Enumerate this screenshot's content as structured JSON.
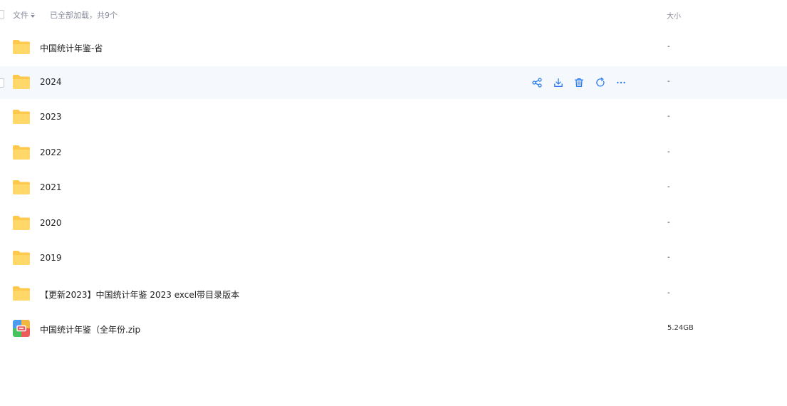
{
  "header": {
    "file_column_label": "文件",
    "load_status": "已全部加载，共9个",
    "size_column_label": "大小"
  },
  "files": [
    {
      "name": "中国统计年鉴-省",
      "size": "-",
      "type": "folder"
    },
    {
      "name": "2024",
      "size": "-",
      "type": "folder"
    },
    {
      "name": "2023",
      "size": "-",
      "type": "folder"
    },
    {
      "name": "2022",
      "size": "-",
      "type": "folder"
    },
    {
      "name": "2021",
      "size": "-",
      "type": "folder"
    },
    {
      "name": "2020",
      "size": "-",
      "type": "folder"
    },
    {
      "name": "2019",
      "size": "-",
      "type": "folder"
    },
    {
      "name": "【更新2023】中国统计年鉴 2023 excel带目录版本",
      "size": "-",
      "type": "folder"
    },
    {
      "name": "中国统计年鉴（全年份.zip",
      "size": "5.24GB",
      "type": "zip"
    }
  ],
  "hover_row_actions": [
    "share-icon",
    "download-icon",
    "delete-icon",
    "refresh-icon",
    "more-icon"
  ],
  "colors": {
    "action_blue": "#2b7bf0",
    "folder_yellow": "#ffc94d",
    "hover_bg": "#f5f8fd",
    "muted_text": "#878c9c"
  }
}
